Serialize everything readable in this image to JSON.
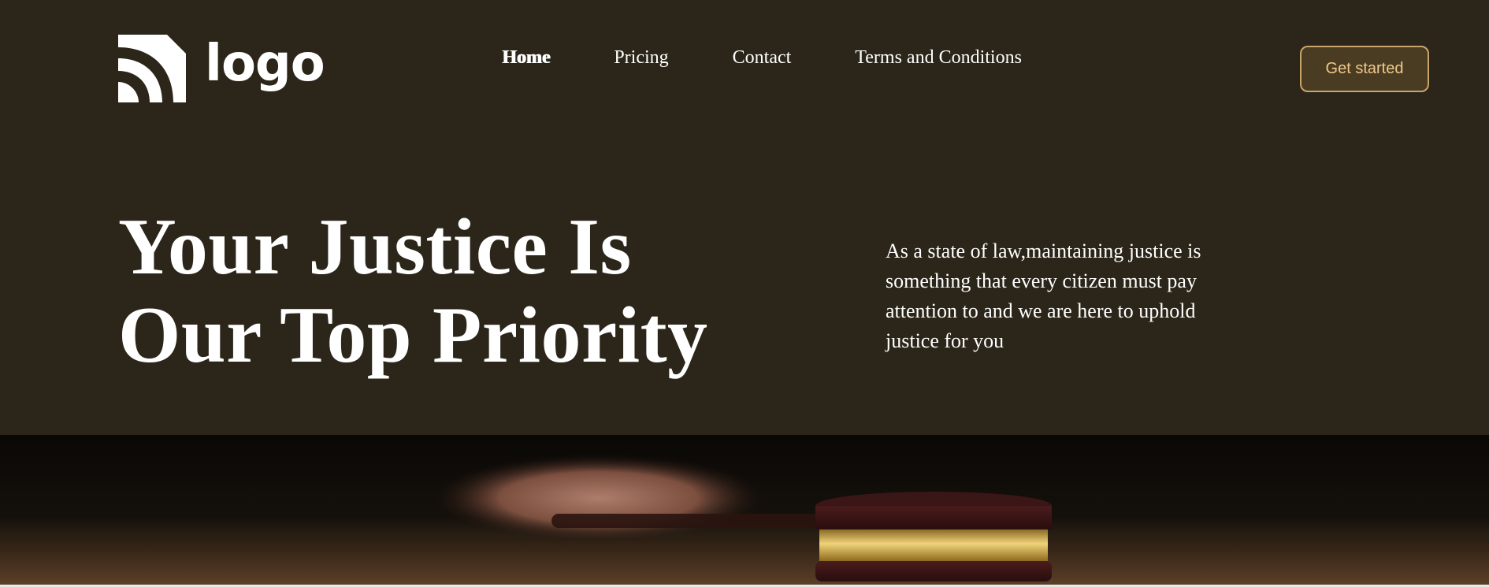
{
  "header": {
    "logo_text": "logo",
    "nav": [
      {
        "label": "Home",
        "active": true
      },
      {
        "label": "Pricing"
      },
      {
        "label": "Contact"
      },
      {
        "label": "Terms and Conditions"
      }
    ],
    "cta_label": "Get started"
  },
  "hero": {
    "title_line1": "Your Justice Is",
    "title_line2": "Our Top Priority",
    "description": "As a state of law,maintaining justice is something that every citizen must pay attention to and we are here to uphold justice for you"
  },
  "banner": {
    "image_subject": "judge-gavel-photo"
  },
  "colors": {
    "background": "#2b2619",
    "cta_background": "#4a3c22",
    "cta_border": "#c9a46d",
    "cta_text": "#f0c98a",
    "text": "#ffffff"
  }
}
